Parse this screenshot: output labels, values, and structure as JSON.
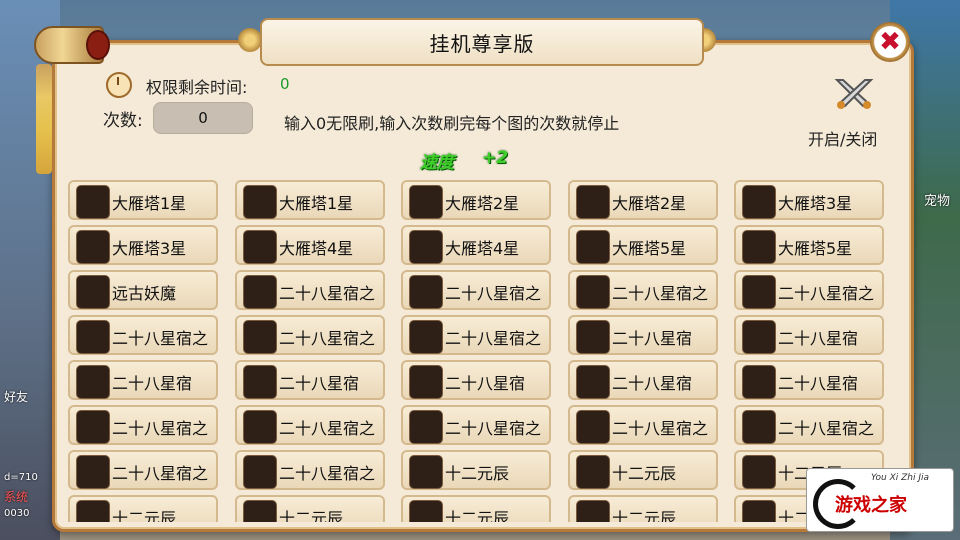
{
  "window": {
    "title": "挂机尊享版"
  },
  "permission": {
    "label": "权限剩余时间:",
    "value": "0"
  },
  "count": {
    "label": "次数:",
    "value": "0",
    "hint": "输入0无限刷,输入次数刷完每个图的次数就停止"
  },
  "toggle": {
    "label": "开启/关闭",
    "icon": "crossed-swords-icon"
  },
  "speed": {
    "label": "速度",
    "value": "+2"
  },
  "close": {
    "icon": "close-icon",
    "symbol": "✖"
  },
  "background": {
    "left_labels": [
      "好友",
      "d=710",
      "系统",
      "0030"
    ],
    "right_label": "宠物"
  },
  "watermark": {
    "sub": "You Xi Zhi Jia",
    "main": "游戏之家"
  },
  "dungeons": [
    [
      "大雁塔1星",
      "大雁塔1星",
      "大雁塔2星",
      "大雁塔2星",
      "大雁塔3星"
    ],
    [
      "大雁塔3星",
      "大雁塔4星",
      "大雁塔4星",
      "大雁塔5星",
      "大雁塔5星"
    ],
    [
      "远古妖魔",
      "二十八星宿之",
      "二十八星宿之",
      "二十八星宿之",
      "二十八星宿之"
    ],
    [
      "二十八星宿之",
      "二十八星宿之",
      "二十八星宿之",
      "二十八星宿",
      "二十八星宿"
    ],
    [
      "二十八星宿",
      "二十八星宿",
      "二十八星宿",
      "二十八星宿",
      "二十八星宿"
    ],
    [
      "二十八星宿之",
      "二十八星宿之",
      "二十八星宿之",
      "二十八星宿之",
      "二十八星宿之"
    ],
    [
      "二十八星宿之",
      "二十八星宿之",
      "十二元辰",
      "十二元辰",
      "十二元辰"
    ],
    [
      "十二元辰",
      "十二元辰",
      "十二元辰",
      "十二元辰",
      "十二元辰"
    ]
  ]
}
